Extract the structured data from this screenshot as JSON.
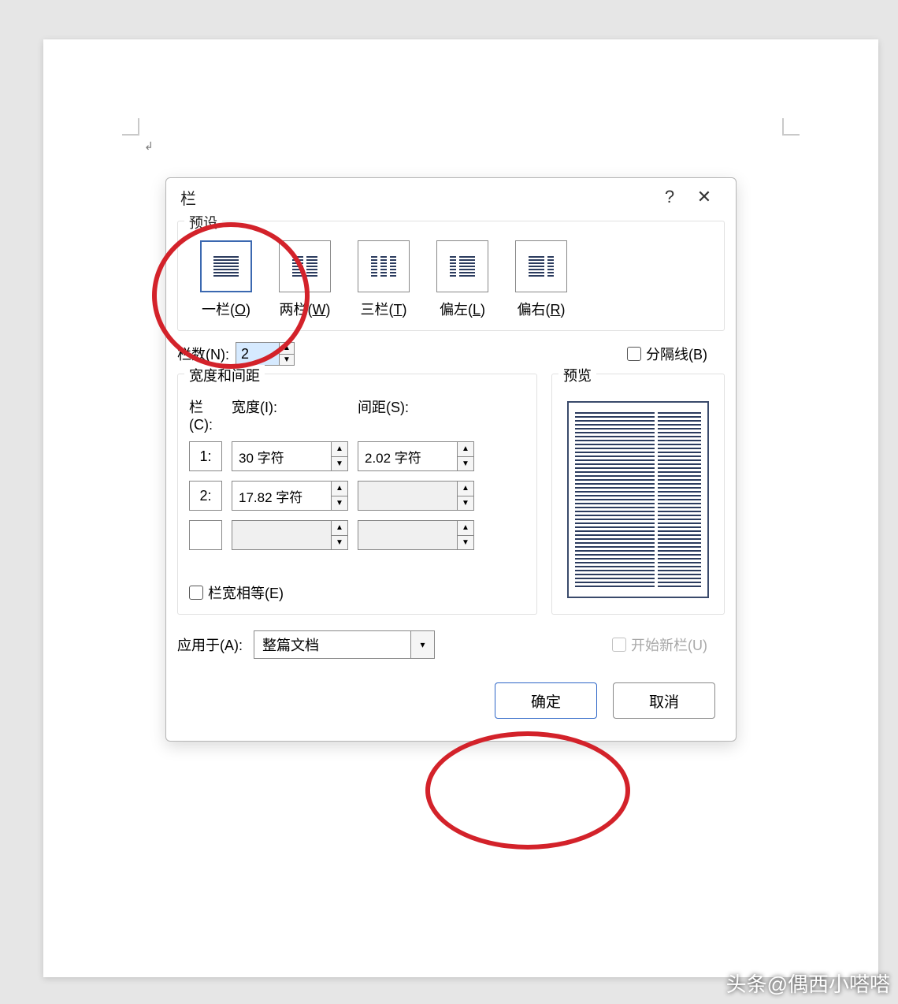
{
  "dialog": {
    "title": "栏",
    "presets": [
      {
        "label": "一栏",
        "key": "O"
      },
      {
        "label": "两栏",
        "key": "W"
      },
      {
        "label": "三栏",
        "key": "T"
      },
      {
        "label": "偏左",
        "key": "L"
      },
      {
        "label": "偏右",
        "key": "R"
      }
    ],
    "numColsLabel": "栏数(N):",
    "numColsValue": "2",
    "lineBetweenLabel": "分隔线(B)",
    "widthSpacingTitle": "宽度和间距",
    "colHeader": "栏(C):",
    "widthHeader": "宽度(I):",
    "spacingHeader": "间距(S):",
    "rows": [
      {
        "idx": "1:",
        "width": "30 字符",
        "spacing": "2.02 字符"
      },
      {
        "idx": "2:",
        "width": "17.82 字符",
        "spacing": ""
      },
      {
        "idx": "",
        "width": "",
        "spacing": ""
      }
    ],
    "equalLabel": "栏宽相等(E)",
    "previewTitle": "预览",
    "applyLabel": "应用于(A):",
    "applyValue": "整篇文档",
    "newColLabel": "开始新栏(U)",
    "okLabel": "确定",
    "cancelLabel": "取消"
  },
  "watermark": "头条@偶西小嗒嗒"
}
